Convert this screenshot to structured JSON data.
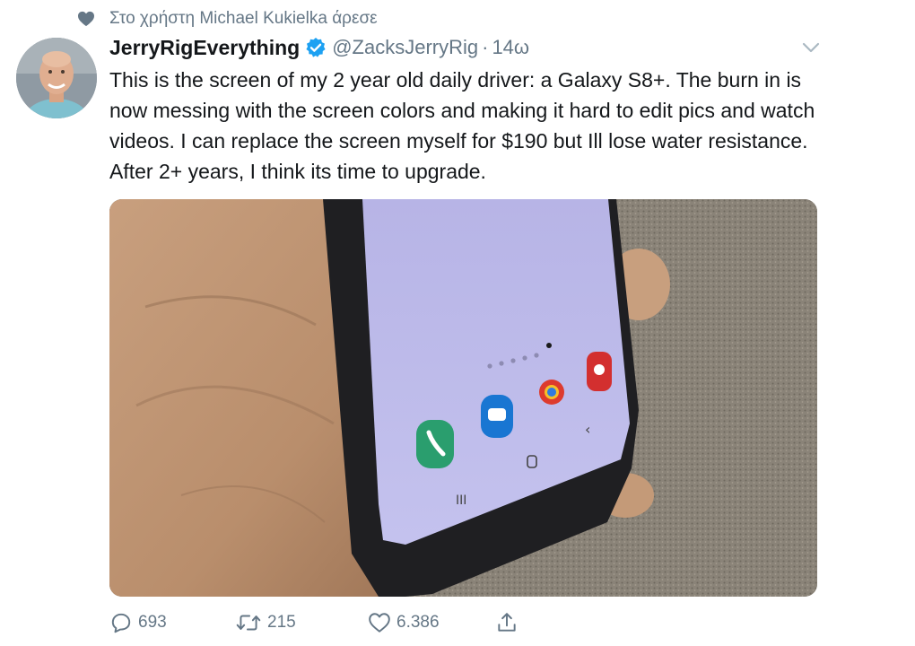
{
  "context": {
    "text": "Στο χρήστη Michael Kukielka άρεσε",
    "icon": "heart-icon"
  },
  "author": {
    "name": "JerryRigEverything",
    "handle": "@ZacksJerryRig",
    "separator": "·",
    "time": "14ω",
    "verified": true
  },
  "tweet": {
    "text": "This is the screen of my 2 year old daily driver: a Galaxy S8+. The burn in is now messing with the screen colors and making it hard to edit pics and watch videos. I can replace the screen myself for $190 but Ill lose water resistance. After 2+ years, I think its time to upgrade."
  },
  "actions": {
    "replies": "693",
    "retweets": "215",
    "likes": "6.386"
  },
  "colors": {
    "text": "#14171a",
    "secondary": "#657786",
    "verified": "#1da1f2"
  }
}
